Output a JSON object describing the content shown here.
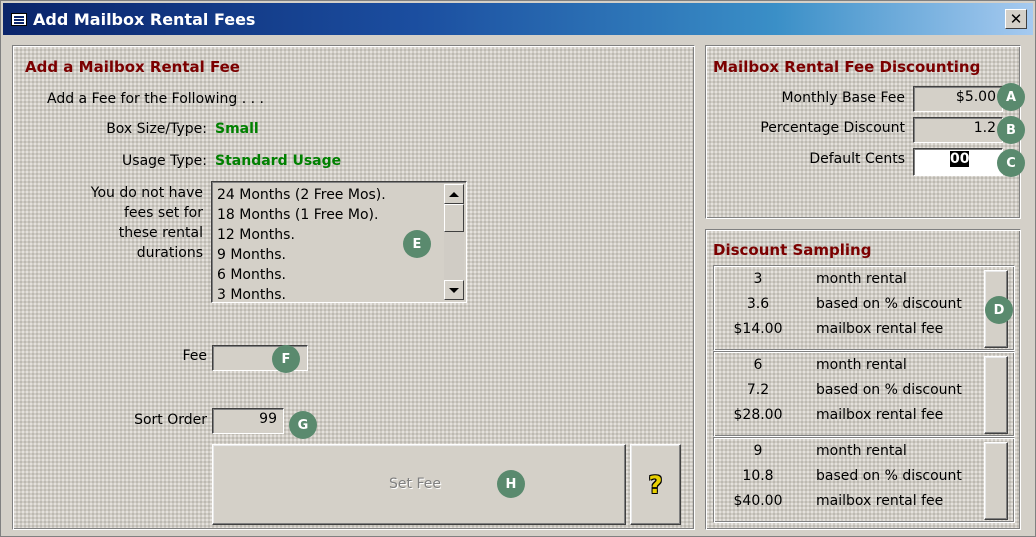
{
  "window": {
    "title": "Add Mailbox Rental Fees",
    "close_label": "✕"
  },
  "add_fee": {
    "title": "Add a Mailbox Rental Fee",
    "intro": "Add a Fee for the Following . . .",
    "box_size_label": "Box Size/Type:",
    "box_size_value": "Small",
    "usage_label": "Usage Type:",
    "usage_value": "Standard Usage",
    "no_fees_lines": [
      "You do not have",
      "fees set for",
      "these rental",
      "durations"
    ],
    "durations": [
      "24 Months (2 Free Mos).",
      "18 Months (1 Free Mo).",
      "12 Months.",
      "9 Months.",
      "6 Months.",
      "3 Months."
    ],
    "fee_label": "Fee",
    "fee_value": "",
    "sort_order_label": "Sort Order",
    "sort_order_value": "99",
    "set_fee_label": "Set Fee",
    "help_label": "?"
  },
  "discounting": {
    "title": "Mailbox Rental Fee Discounting",
    "monthly_base_fee_label": "Monthly Base Fee",
    "monthly_base_fee_value": "$5.00",
    "percentage_discount_label": "Percentage Discount",
    "percentage_discount_value": "1.2",
    "default_cents_label": "Default Cents",
    "default_cents_value": "00"
  },
  "sampling": {
    "title": "Discount Sampling",
    "samples": [
      {
        "months": "3",
        "discount": "3.6",
        "fee": "$14.00"
      },
      {
        "months": "6",
        "discount": "7.2",
        "fee": "$28.00"
      },
      {
        "months": "9",
        "discount": "10.8",
        "fee": "$40.00"
      }
    ],
    "line1": "month rental",
    "line2": "based on % discount",
    "line3": "mailbox rental fee"
  },
  "callouts": {
    "A": "A",
    "B": "B",
    "C": "C",
    "D": "D",
    "E": "E",
    "F": "F",
    "G": "G",
    "H": "H"
  },
  "colors": {
    "section_title": "#7b0000",
    "value_green": "#008000",
    "callout_badge": "#5a8a6e",
    "title_bar_start": "#0a246a"
  }
}
